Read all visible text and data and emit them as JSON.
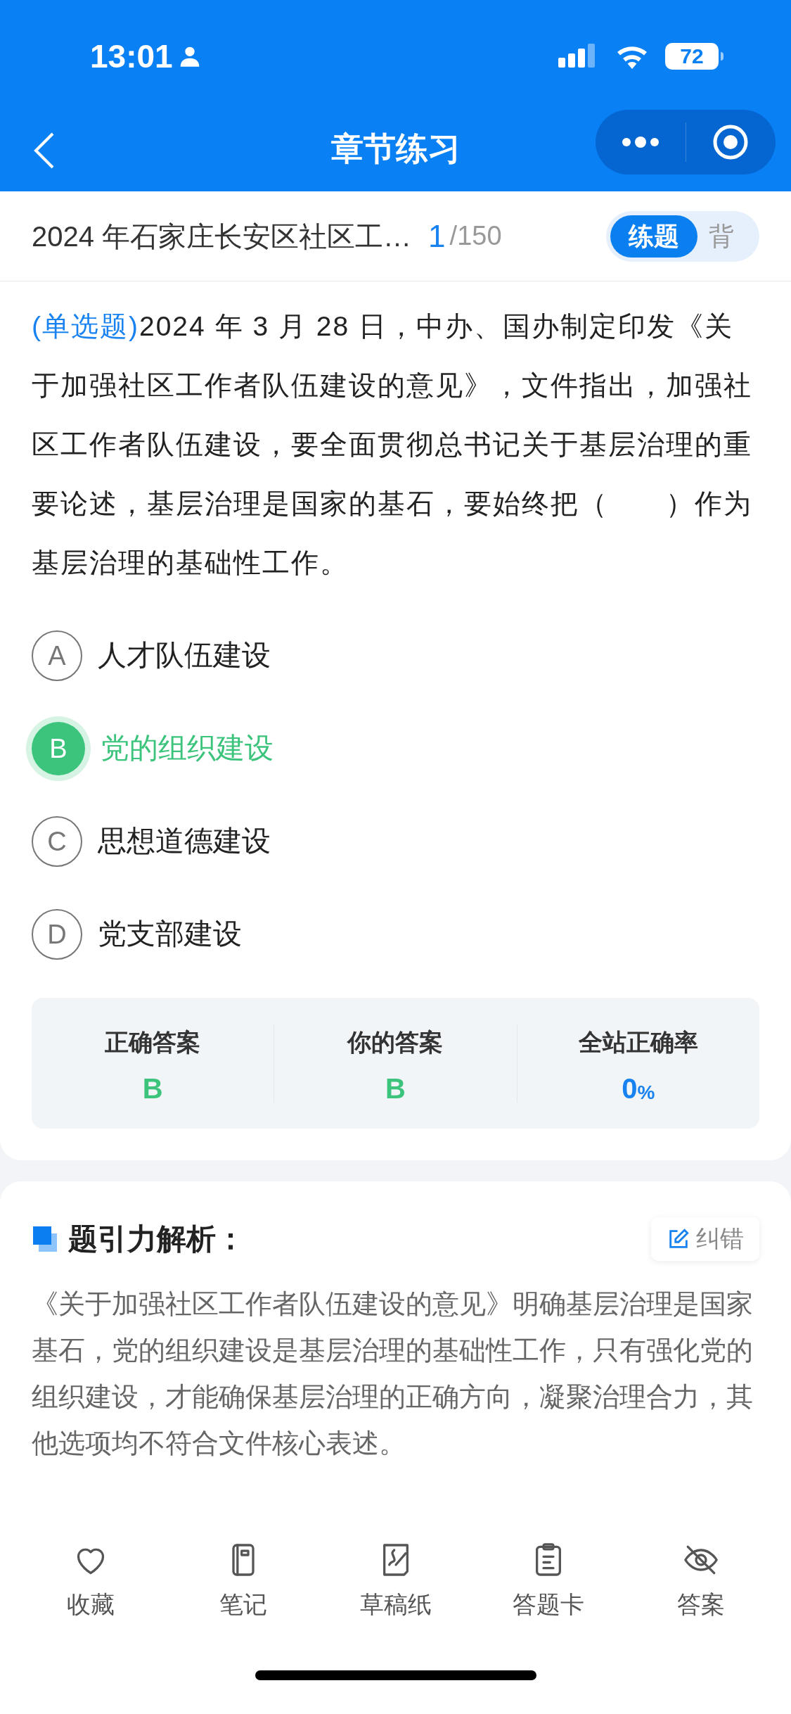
{
  "status_bar": {
    "time": "13:01",
    "battery": "72"
  },
  "nav": {
    "title": "章节练习"
  },
  "header": {
    "title": "2024 年石家庄长安区社区工…",
    "current": "1",
    "total": "/150",
    "modes": [
      {
        "label": "练题",
        "selected": true
      },
      {
        "label": "背",
        "selected": false
      }
    ]
  },
  "question": {
    "type": "(单选题)",
    "text": "2024 年 3 月 28 日，中办、国办制定印发《关于加强社区工作者队伍建设的意见》，文件指出，加强社区工作者队伍建设，要全面贯彻总书记关于基层治理的重要论述，基层治理是国家的基石，要始终把（　　）作为基层治理的基础性工作。",
    "options": [
      {
        "letter": "A",
        "text": "人才队伍建设",
        "selected": false
      },
      {
        "letter": "B",
        "text": "党的组织建设",
        "selected": true
      },
      {
        "letter": "C",
        "text": "思想道德建设",
        "selected": false
      },
      {
        "letter": "D",
        "text": "党支部建设",
        "selected": false
      }
    ]
  },
  "stats": [
    {
      "label": "正确答案",
      "value": "B",
      "color": "#3cc47c"
    },
    {
      "label": "你的答案",
      "value": "B",
      "color": "#3cc47c"
    },
    {
      "label": "全站正确率",
      "value": "0",
      "unit": "%",
      "color": "#1782f0"
    }
  ],
  "analysis": {
    "title": "题引力解析：",
    "report": "纠错",
    "text": "《关于加强社区工作者队伍建设的意见》明确基层治理是国家基石，党的组织建设是基层治理的基础性工作，只有强化党的组织建设，才能确保基层治理的正确方向，凝聚治理合力，其他选项均不符合文件核心表述。"
  },
  "toolbar": [
    {
      "kind": "heart",
      "label": "收藏"
    },
    {
      "kind": "notebook",
      "label": "笔记"
    },
    {
      "kind": "draft",
      "label": "草稿纸"
    },
    {
      "kind": "card",
      "label": "答题卡"
    },
    {
      "kind": "eye",
      "label": "答案"
    }
  ]
}
